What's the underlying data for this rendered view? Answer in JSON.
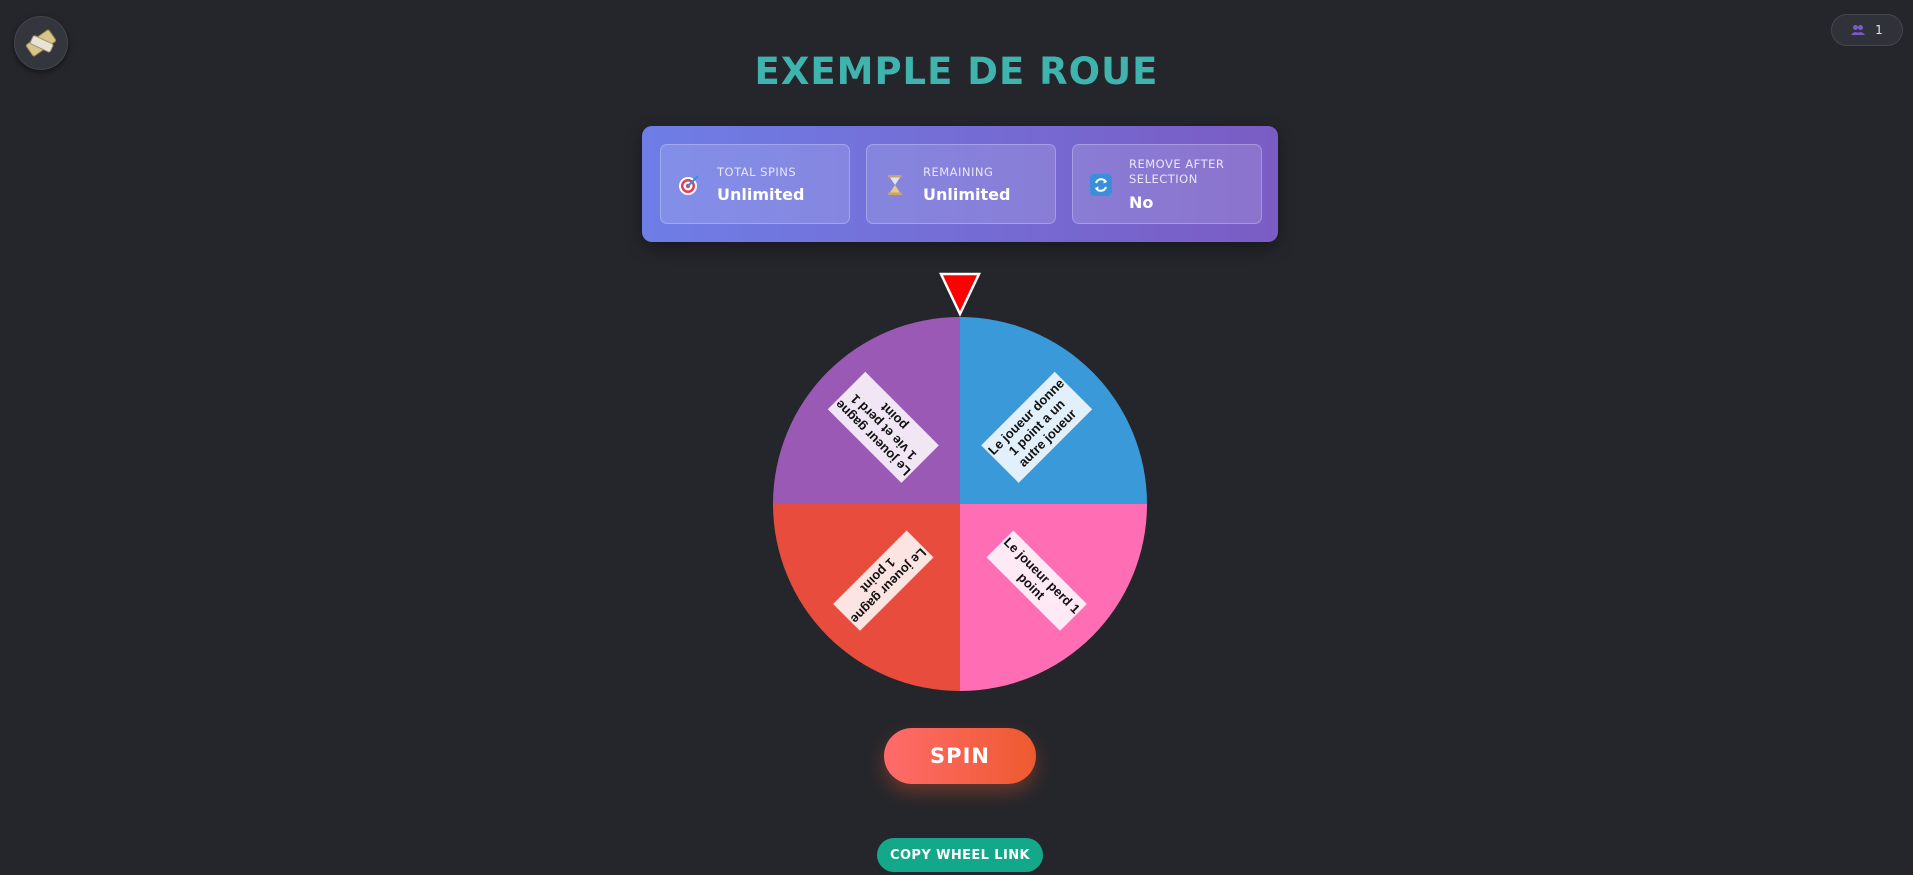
{
  "header": {
    "title": "EXEMPLE DE ROUE",
    "users_count": "1"
  },
  "stats": [
    {
      "label": "TOTAL SPINS",
      "value": "Unlimited",
      "icon": "target-icon"
    },
    {
      "label": "REMAINING",
      "value": "Unlimited",
      "icon": "hourglass-icon"
    },
    {
      "label": "REMOVE AFTER SELECTION",
      "value": "No",
      "icon": "refresh-icon"
    }
  ],
  "wheel": {
    "pointer_color": "#ff0000",
    "segments": [
      {
        "label": "Le joueur donne 1 point a un autre joueur",
        "lines": [
          "Le joueur donne",
          "1 point a un",
          "autre joueur"
        ],
        "color": "#3a9ad9"
      },
      {
        "label": "Le joueur perd 1 point",
        "lines": [
          "Le joueur perd 1",
          "point"
        ],
        "color": "#ff6eb4"
      },
      {
        "label": "Le joueur gagne 1 point",
        "lines": [
          "Le joueur gagne",
          "1 point"
        ],
        "color": "#e74c3c"
      },
      {
        "label": "Le joueur gagne 1 vie et perd 1 point",
        "lines": [
          "Le joueur gagne",
          "1 vie et perd 1",
          "point"
        ],
        "color": "#9b59b6"
      }
    ]
  },
  "actions": {
    "spin_label": "SPIN",
    "copy_label": "COPY WHEEL LINK"
  },
  "colors": {
    "background": "#25262b",
    "title": "#3fb3ad",
    "panel_gradient_start": "#6e7ee6",
    "panel_gradient_end": "#7a5cc4",
    "spin_button": "#ff6b6b",
    "copy_button": "#14a88a"
  }
}
